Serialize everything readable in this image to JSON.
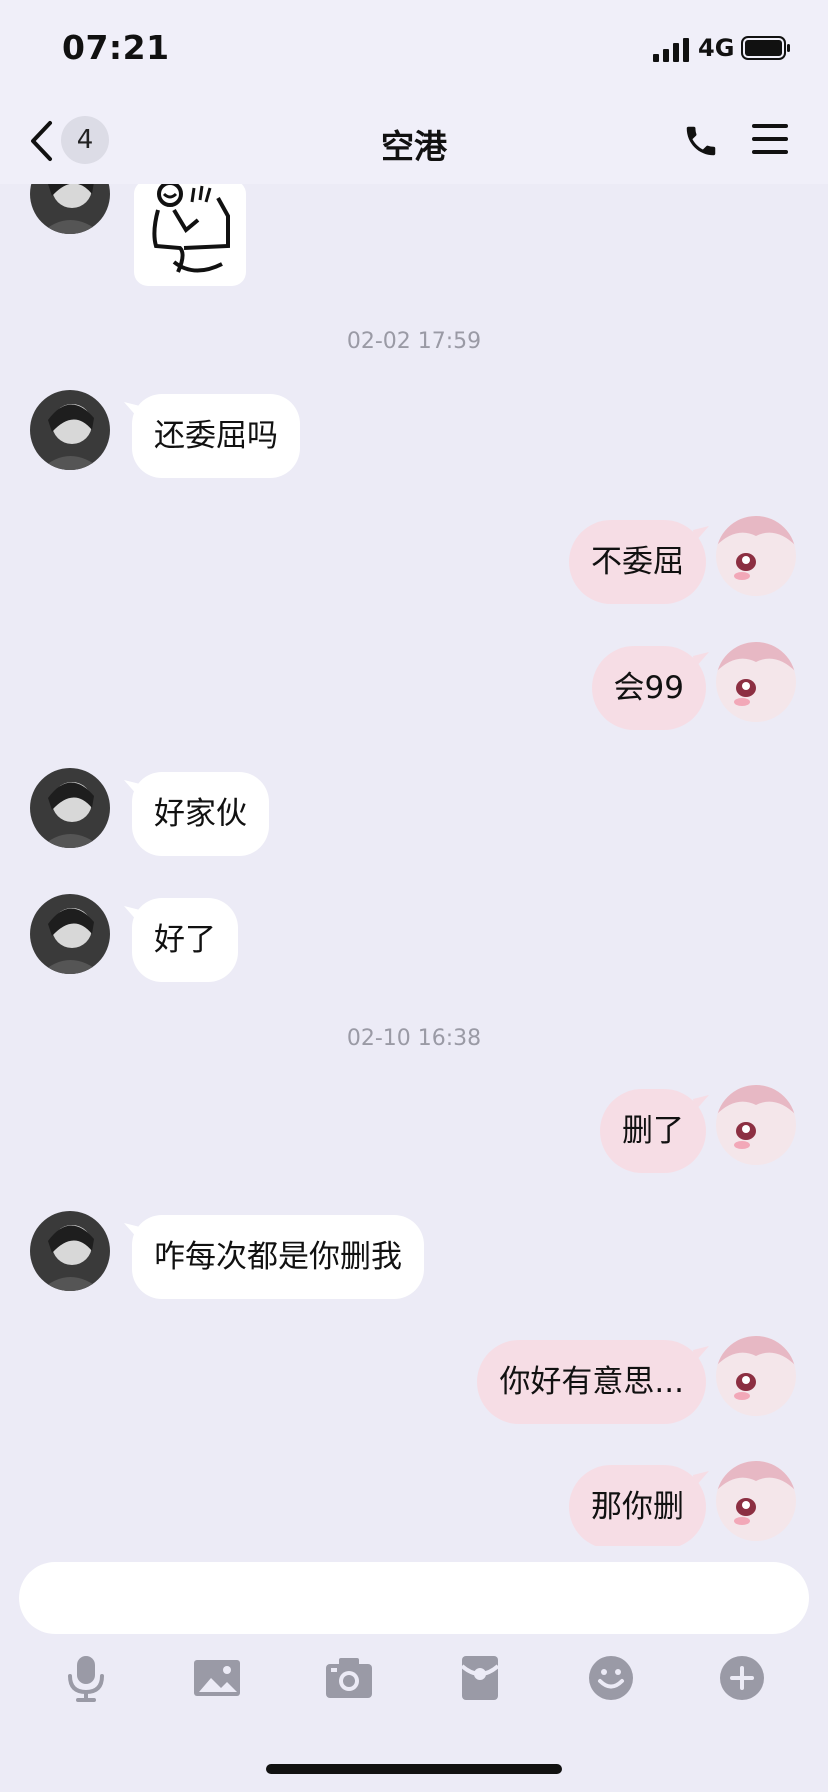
{
  "status_bar": {
    "time": "07:21",
    "network": "4G"
  },
  "header": {
    "unread_count": "4",
    "title": "空港"
  },
  "messages": [
    {
      "type": "sticker",
      "side": "left"
    },
    {
      "type": "timestamp",
      "text": "02-02 17:59"
    },
    {
      "type": "text",
      "side": "left",
      "text": "还委屈吗"
    },
    {
      "type": "text",
      "side": "right",
      "text": "不委屈"
    },
    {
      "type": "text",
      "side": "right",
      "text": "会99"
    },
    {
      "type": "text",
      "side": "left",
      "text": "好家伙"
    },
    {
      "type": "text",
      "side": "left",
      "text": "好了"
    },
    {
      "type": "timestamp",
      "text": "02-10 16:38"
    },
    {
      "type": "text",
      "side": "right",
      "text": "删了"
    },
    {
      "type": "text",
      "side": "left",
      "text": "咋每次都是你删我"
    },
    {
      "type": "text",
      "side": "right",
      "text": "你好有意思..."
    },
    {
      "type": "text",
      "side": "right",
      "text": "那你删"
    }
  ],
  "composer": {
    "input_value": "",
    "toolbar": [
      "microphone-icon",
      "image-icon",
      "camera-icon",
      "red-packet-icon",
      "emoji-icon",
      "plus-icon"
    ]
  },
  "colors": {
    "background": "#ecebf6",
    "bubble_left": "#ffffff",
    "bubble_right": "#f6dde5",
    "icon_gray": "#9a9aa6"
  }
}
